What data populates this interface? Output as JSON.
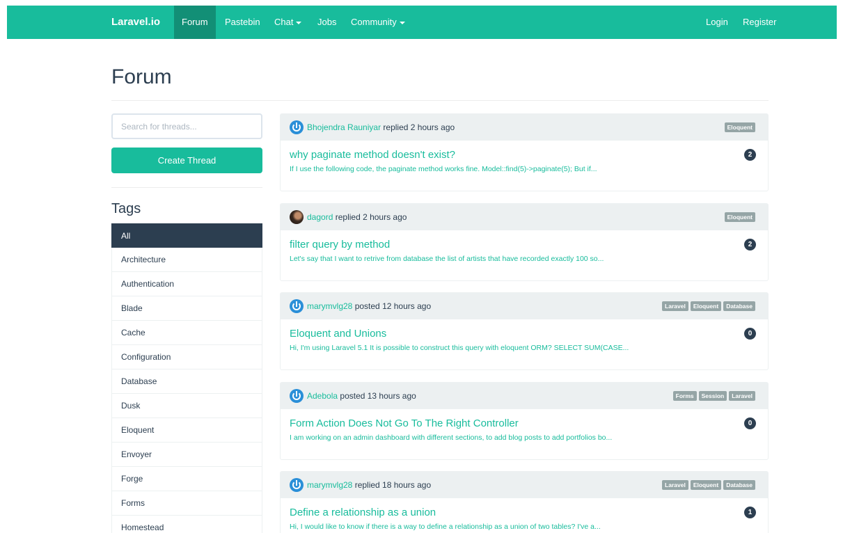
{
  "navbar": {
    "brand": "Laravel.io",
    "items": [
      {
        "label": "Forum"
      },
      {
        "label": "Pastebin"
      },
      {
        "label": "Chat"
      },
      {
        "label": "Jobs"
      },
      {
        "label": "Community"
      }
    ],
    "right": [
      {
        "label": "Login"
      },
      {
        "label": "Register"
      }
    ],
    "accent": "#18bc9c"
  },
  "page": {
    "title": "Forum"
  },
  "sidebar": {
    "search_placeholder": "Search for threads...",
    "create_label": "Create Thread",
    "tags_title": "Tags",
    "tags": [
      "All",
      "Architecture",
      "Authentication",
      "Blade",
      "Cache",
      "Configuration",
      "Database",
      "Dusk",
      "Eloquent",
      "Envoyer",
      "Forge",
      "Forms",
      "Homestead"
    ],
    "active_tag": "All"
  },
  "threads": [
    {
      "avatar_icon": "power-icon",
      "author": "Bhojendra Rauniyar",
      "action": "replied 2 hours ago",
      "tags": [
        "Eloquent"
      ],
      "title": "why paginate method doesn't exist?",
      "excerpt": "If I use the following code, the paginate method works fine. Model::find(5)->paginate(5); But if...",
      "replies": "2"
    },
    {
      "avatar_icon": "user-photo",
      "author": "dagord",
      "action": "replied 2 hours ago",
      "tags": [
        "Eloquent"
      ],
      "title": "filter query by method",
      "excerpt": "Let's say that I want to retrive from database the list of artists that have recorded exactly 100 so...",
      "replies": "2"
    },
    {
      "avatar_icon": "power-icon",
      "author": "marymvlg28",
      "action": "posted 12 hours ago",
      "tags": [
        "Laravel",
        "Eloquent",
        "Database"
      ],
      "title": "Eloquent and Unions",
      "excerpt": "Hi, I'm using Laravel 5.1 It is possible to construct this query with eloquent ORM? SELECT SUM(CASE...",
      "replies": "0"
    },
    {
      "avatar_icon": "power-icon",
      "author": "Adebola",
      "action": "posted 13 hours ago",
      "tags": [
        "Forms",
        "Session",
        "Laravel"
      ],
      "title": "Form Action Does Not Go To The Right Controller",
      "excerpt": "I am working on an admin dashboard with different sections, to add blog posts to add portfolios bo...",
      "replies": "0"
    },
    {
      "avatar_icon": "power-icon",
      "author": "marymvlg28",
      "action": "replied 18 hours ago",
      "tags": [
        "Laravel",
        "Eloquent",
        "Database"
      ],
      "title": "Define a relationship as a union",
      "excerpt": "Hi, I would like to know if there is a way to define a relationship as a union of two tables? I've a...",
      "replies": "1"
    }
  ]
}
